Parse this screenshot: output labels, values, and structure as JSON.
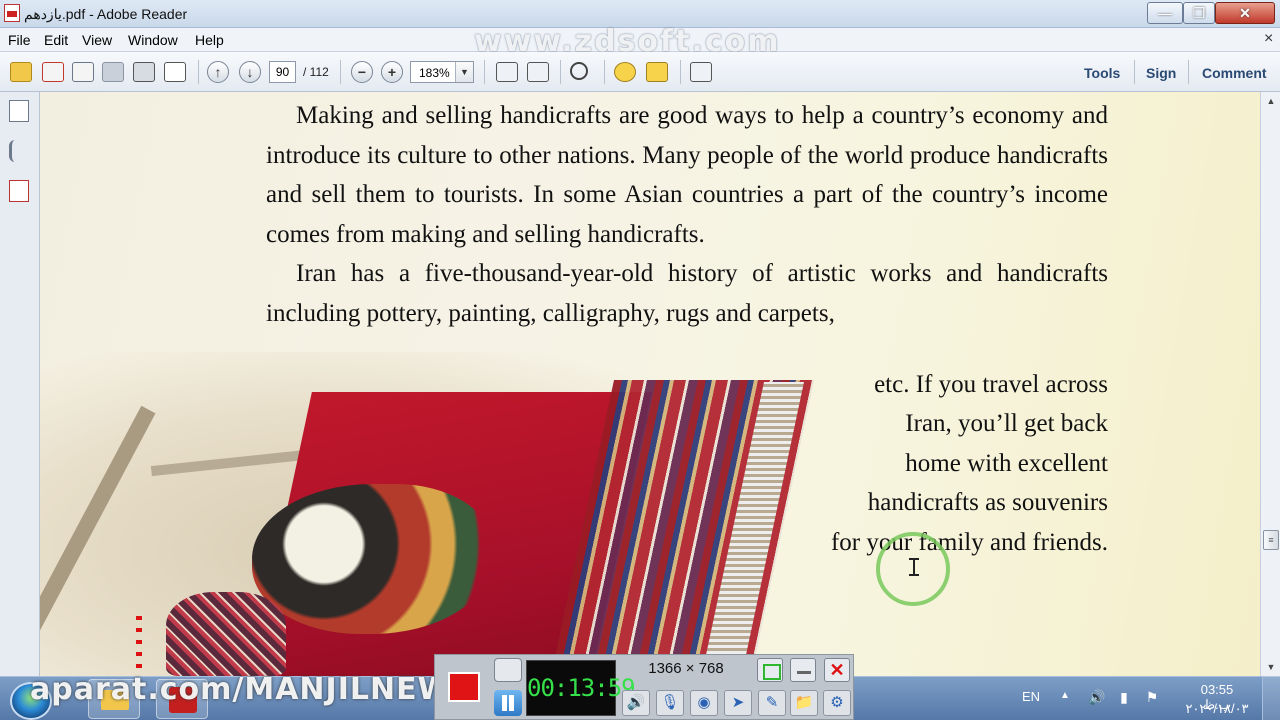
{
  "window": {
    "title": "یازدهم.pdf - Adobe Reader",
    "min_glyph": "—",
    "max_glyph": "❐",
    "close_glyph": "✕"
  },
  "menu": {
    "items": [
      "File",
      "Edit",
      "View",
      "Window",
      "Help"
    ],
    "watermark": "www.zdsoft.com",
    "close_glyph": "×"
  },
  "toolbar": {
    "page_current": "90",
    "page_total": "/ 112",
    "zoom": "183%",
    "zoom_arrow": "▼",
    "zoom_out_glyph": "−",
    "zoom_in_glyph": "+",
    "prev_glyph": "↑",
    "next_glyph": "↓",
    "tools_label": "Tools",
    "sign_label": "Sign",
    "comment_label": "Comment"
  },
  "document": {
    "paragraph1": "Making and selling handicrafts are good ways to help a country’s economy and introduce its culture to other nations. Many people of the world produce handicrafts and sell them to tourists. In some Asian countries a part of the country’s income comes from making and selling handicrafts.",
    "paragraph2_top": "Iran has a five-thousand-year-old history of artistic works and handicrafts including pottery, painting, calligraphy, rugs and carpets,",
    "paragraph2_lines": [
      "etc. If you travel across",
      "Iran, you’ll get back",
      "home with excellent",
      "handicrafts as souvenirs",
      "for your family and friends."
    ]
  },
  "scrollbar": {
    "up": "▲",
    "down": "▼",
    "thumb": "≡"
  },
  "recorder": {
    "timer": "00:13:59",
    "resolution": "1366 × 768",
    "close_glyph": "✕",
    "tools": [
      {
        "icon": "speaker-icon",
        "glyph": "🔊"
      },
      {
        "icon": "microphone-icon",
        "glyph": "🎙"
      },
      {
        "icon": "webcam-icon",
        "glyph": "◉"
      },
      {
        "icon": "cursor-icon",
        "glyph": "➤"
      },
      {
        "icon": "pen-icon",
        "glyph": "✎"
      },
      {
        "icon": "folder-icon",
        "glyph": "📁"
      },
      {
        "icon": "settings-icon",
        "glyph": "⚙"
      }
    ]
  },
  "taskbar": {
    "watermark": "aparat.com/MANJILNEWS",
    "language": "EN",
    "tray_arrow": "▲",
    "volume_glyph": "🔊",
    "network_glyph": "▮",
    "flag_glyph": "⚑",
    "clock_time": "03:55 ب.ظ",
    "clock_date": "۲۰۲۰/۱۸/۰۳"
  },
  "colors": {
    "accent": "#2b4a73",
    "record_red": "#e01414",
    "timer_green": "#36e04a",
    "cursor_ring": "#78c85a"
  }
}
